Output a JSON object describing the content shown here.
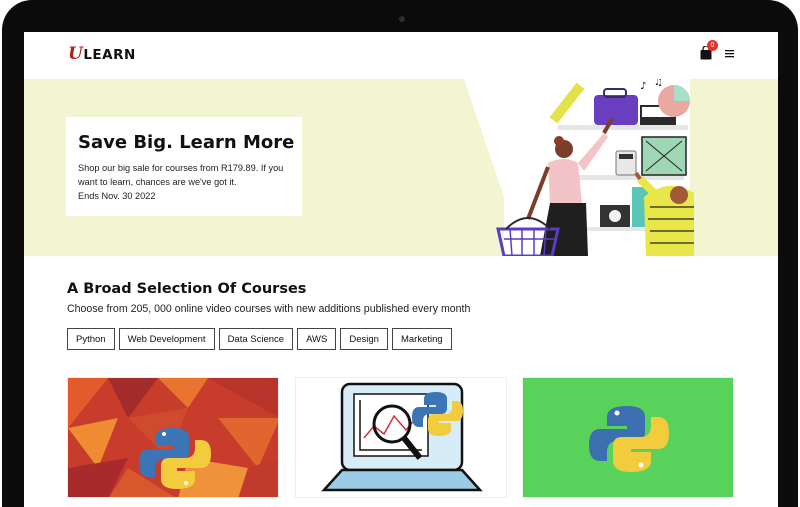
{
  "brand": {
    "logo_mark": "U",
    "logo_text": "LEARN"
  },
  "header": {
    "cart_count": "0",
    "cart_icon": "shopping-bag-icon",
    "menu_icon": "hamburger-menu-icon"
  },
  "hero": {
    "title": "Save Big. Learn More",
    "body": "Shop our big sale for courses from R179.89. If you want to learn, chances are we've got it.",
    "ends": "Ends Nov. 30 2022"
  },
  "courses": {
    "title": "A Broad Selection Of Courses",
    "subtitle": "Choose from 205, 000 online video courses with new additions published every month",
    "tabs": [
      "Python",
      "Web Development",
      "Data Science",
      "AWS",
      "Design",
      "Marketing"
    ]
  },
  "colors": {
    "brand_red": "#b3201f",
    "hero_bg": "#f3f4d2",
    "badge": "#e4322b",
    "card3_bg": "#58d25a"
  },
  "cards": [
    {
      "image": "python-logo-on-orange-geometric"
    },
    {
      "image": "laptop-with-chart-and-python-logo"
    },
    {
      "image": "python-logo-on-green"
    }
  ]
}
